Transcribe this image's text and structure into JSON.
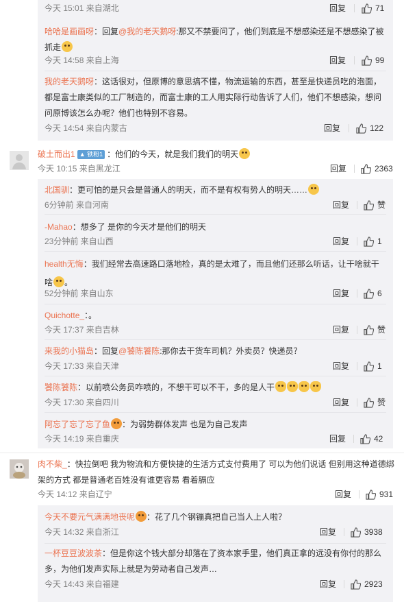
{
  "ui": {
    "reply_label": "回复",
    "like_label": "赞"
  },
  "block1": {
    "top_meta": {
      "date": "今天 15:01 来自湖北",
      "likes": "71"
    },
    "comments": [
      {
        "user": "哈哈是画画呀",
        "reply_prefix": "：回复",
        "at": "@我的老天鹅呀",
        "text": ":那又不禁要问了，他们到底是不想感染还是不想感染了被抓走",
        "emoji": "scared-emoji",
        "date": "今天 14:58 来自上海",
        "likes": "99"
      },
      {
        "user": "我的老天鹅呀",
        "text": "：这话很对，但原博的意思搞不懂，物流运输的东西，甚至是快递员吃的泡面，都是富士康类似的工厂制造的，而富士康的工人用实际行动告诉了人们，他们不想感染，想问问原博该怎么办呢？他们也特别不容易。",
        "date": "今天 14:54 来自内蒙古",
        "likes": "122"
      }
    ]
  },
  "thread1": {
    "user": "破土而出1",
    "badge": "铁粉1",
    "text": "：他们的今天，就是我们我们的明天",
    "emoji": "thinking-emoji",
    "date": "今天 10:15 来自黑龙江",
    "likes": "2363",
    "replies": [
      {
        "user": "北国驯",
        "text": "：更可怕的是只会是普通人的明天，而不是有权有势人的明天……",
        "emoji": "cry-emoji",
        "date": "6分钟前 来自河南",
        "likes": "赞"
      },
      {
        "user": "-Mahao",
        "text": "：想多了 是你的今天才是他们的明天",
        "date": "23分钟前 来自山西",
        "likes": "1"
      },
      {
        "user": "health无悔",
        "text": "：我们经常去高速路口落地检，真的是太难了，而且他们还那么听话，让干啥就干啥",
        "emoji": "cry-emoji",
        "date": "52分钟前 来自山东",
        "likes": "6"
      },
      {
        "user": "Quichotte_",
        "text": "：。",
        "date": "今天 17:37 来自吉林",
        "likes": "赞"
      },
      {
        "user": "来我的小猫岛",
        "reply_prefix": "：回复",
        "at": "@饕陈饕陈",
        "text": ":那你去干货车司机？外卖员？快递员？",
        "date": "今天 17:33 来自天津",
        "likes": "1"
      },
      {
        "user": "饕陈饕陈",
        "text": "：以前喷公务员咋喷的，不想干可以不干，多的是人干",
        "emoji_count": "4",
        "date": "今天 17:30 来自四川",
        "likes": "赞"
      },
      {
        "user": "阿忘了忘了忘了鱼",
        "text": "：为弱势群体发声 也是为自己发声",
        "date": "今天 14:19 来自重庆",
        "likes": "42"
      }
    ]
  },
  "thread2": {
    "user": "肉不柴_",
    "text": "：快拉倒吧 我为物流和方便快捷的生活方式支付费用了 可以为他们说话 但别用这种道德绑架的方式 都是普通老百姓没有谁更容易 看着膈应",
    "date": "今天 14:12 来自辽宁",
    "likes": "931",
    "replies": [
      {
        "user": "今天不要元气满满地丧呢",
        "text": "：花了几个钢镚真把自己当人上人啦？",
        "date": "今天 14:32 来自浙江",
        "likes": "3938"
      },
      {
        "user": "一杯豆豆波波茶",
        "text": "：但是你这个钱大部分却落在了资本家手里，他们真正拿的远没有你付的那么多，为他们发声实际上就是为劳动者自己发声…",
        "date": "今天 14:43 来自福建",
        "likes": "2923"
      }
    ]
  }
}
